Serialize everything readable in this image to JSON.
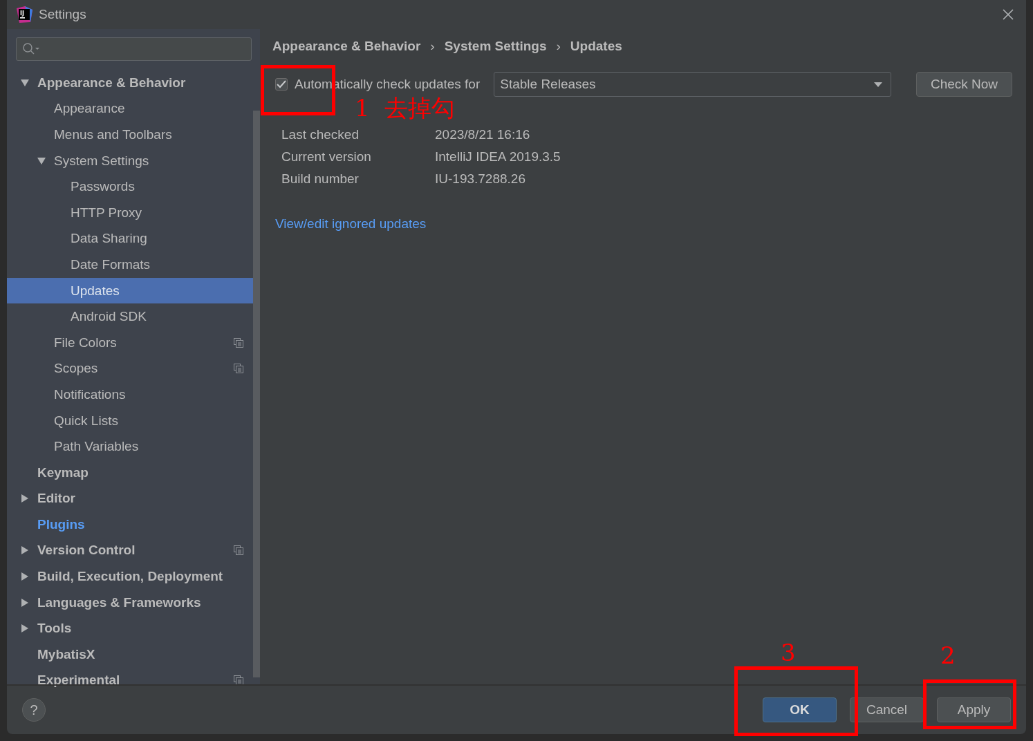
{
  "window": {
    "title": "Settings",
    "logo_text": "IJ"
  },
  "sidebar": {
    "items": [
      {
        "label": "Appearance & Behavior",
        "expanded": true,
        "selected": false,
        "modified": false,
        "project_scoped": false,
        "children": [
          {
            "label": "Appearance",
            "selected": false,
            "modified": false,
            "project_scoped": false
          },
          {
            "label": "Menus and Toolbars",
            "selected": false,
            "modified": false,
            "project_scoped": false
          },
          {
            "label": "System Settings",
            "expanded": true,
            "selected": false,
            "modified": false,
            "project_scoped": false,
            "children": [
              {
                "label": "Passwords",
                "selected": false,
                "modified": false,
                "project_scoped": false
              },
              {
                "label": "HTTP Proxy",
                "selected": false,
                "modified": false,
                "project_scoped": false
              },
              {
                "label": "Data Sharing",
                "selected": false,
                "modified": false,
                "project_scoped": false
              },
              {
                "label": "Date Formats",
                "selected": false,
                "modified": false,
                "project_scoped": false
              },
              {
                "label": "Updates",
                "selected": true,
                "modified": false,
                "project_scoped": false
              },
              {
                "label": "Android SDK",
                "selected": false,
                "modified": false,
                "project_scoped": false
              }
            ]
          },
          {
            "label": "File Colors",
            "selected": false,
            "modified": false,
            "project_scoped": true
          },
          {
            "label": "Scopes",
            "selected": false,
            "modified": false,
            "project_scoped": true
          },
          {
            "label": "Notifications",
            "selected": false,
            "modified": false,
            "project_scoped": false
          },
          {
            "label": "Quick Lists",
            "selected": false,
            "modified": false,
            "project_scoped": false
          },
          {
            "label": "Path Variables",
            "selected": false,
            "modified": false,
            "project_scoped": false
          }
        ]
      },
      {
        "label": "Keymap",
        "selected": false,
        "modified": false,
        "project_scoped": false
      },
      {
        "label": "Editor",
        "expanded": false,
        "selected": false,
        "modified": false,
        "project_scoped": false
      },
      {
        "label": "Plugins",
        "selected": false,
        "modified": true,
        "project_scoped": false
      },
      {
        "label": "Version Control",
        "expanded": false,
        "selected": false,
        "modified": false,
        "project_scoped": true
      },
      {
        "label": "Build, Execution, Deployment",
        "expanded": false,
        "selected": false,
        "modified": false,
        "project_scoped": false
      },
      {
        "label": "Languages & Frameworks",
        "expanded": false,
        "selected": false,
        "modified": false,
        "project_scoped": false
      },
      {
        "label": "Tools",
        "expanded": false,
        "selected": false,
        "modified": false,
        "project_scoped": false
      },
      {
        "label": "MybatisX",
        "selected": false,
        "modified": false,
        "project_scoped": false
      },
      {
        "label": "Experimental",
        "selected": false,
        "modified": false,
        "project_scoped": true
      }
    ]
  },
  "breadcrumb": [
    "Appearance & Behavior",
    "System Settings",
    "Updates"
  ],
  "breadcrumb_separator": "›",
  "auto_check": {
    "label": "Automatically check updates for",
    "checked": true,
    "channel": "Stable Releases"
  },
  "check_now_button": "Check Now",
  "info": [
    {
      "label": "Last checked",
      "value": "2023/8/21 16:16"
    },
    {
      "label": "Current version",
      "value": "IntelliJ IDEA 2019.3.5"
    },
    {
      "label": "Build number",
      "value": "IU-193.7288.26"
    }
  ],
  "ignored_link": "View/edit ignored updates",
  "help_button": "?",
  "buttons": [
    {
      "label": "OK",
      "kind": "default"
    },
    {
      "label": "Cancel",
      "kind": "normal"
    },
    {
      "label": "Apply",
      "kind": "normal"
    }
  ],
  "annotations": [
    {
      "kind": "box"
    },
    {
      "kind": "note",
      "text": "1  去掉勾"
    },
    {
      "kind": "note",
      "text": "3"
    },
    {
      "kind": "box"
    },
    {
      "kind": "note",
      "text": "2"
    },
    {
      "kind": "box"
    }
  ]
}
